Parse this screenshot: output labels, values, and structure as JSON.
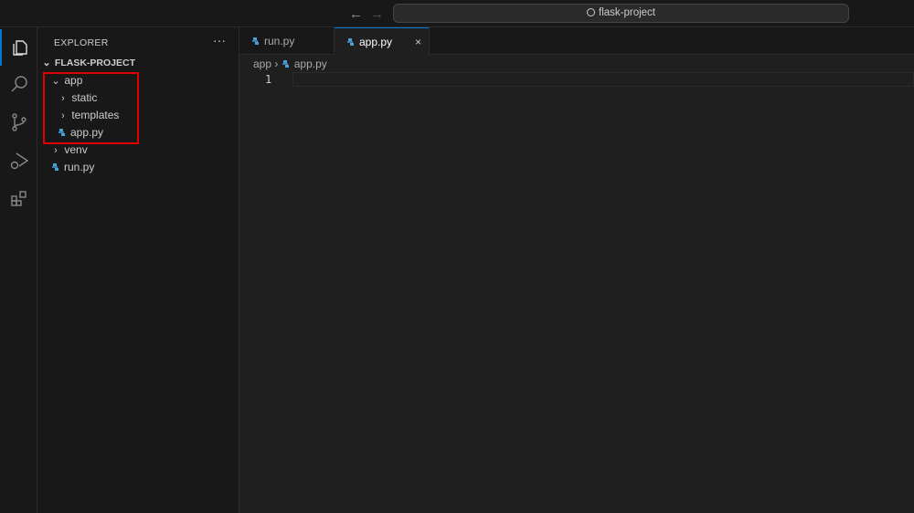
{
  "titlebar": {
    "search_text": "flask-project",
    "back": "←",
    "forward": "→"
  },
  "activity_bar": [
    "explorer",
    "search",
    "source-control",
    "run-debug",
    "extensions"
  ],
  "sidebar": {
    "title": "EXPLORER",
    "more": "···",
    "project": "FLASK-PROJECT",
    "tree": [
      {
        "label": "app",
        "type": "folder",
        "expanded": true
      },
      {
        "label": "static",
        "type": "folder"
      },
      {
        "label": "templates",
        "type": "folder"
      },
      {
        "label": "app.py",
        "type": "python"
      },
      {
        "label": "venv",
        "type": "folder"
      },
      {
        "label": "run.py",
        "type": "python"
      }
    ]
  },
  "tabs": [
    {
      "label": "run.py"
    },
    {
      "label": "app.py",
      "active": true,
      "close": "×"
    }
  ],
  "breadcrumb": {
    "folder": "app",
    "sep": "›",
    "file": "app.py"
  },
  "editor": {
    "line_numbers": [
      "1"
    ]
  },
  "colors": {
    "accent": "#0078d4",
    "highlight": "#e00000",
    "python": "#4a9fd4"
  }
}
